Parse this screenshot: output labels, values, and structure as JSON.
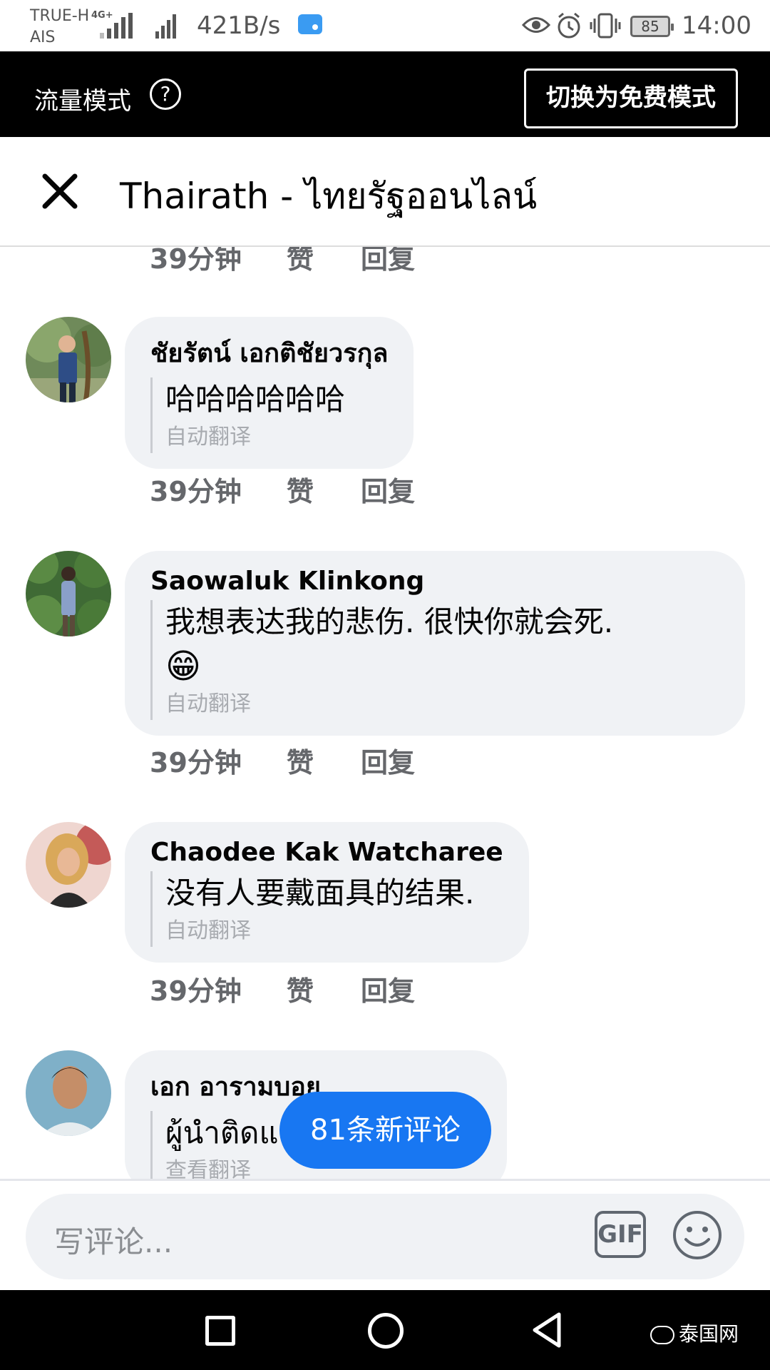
{
  "status_bar": {
    "carrier_line1": "TRUE-H",
    "carrier_line2": "AIS",
    "network_type": "4G+",
    "net_speed": "421B/s",
    "battery_level": "85",
    "time": "14:00",
    "icons": [
      "signal-icon",
      "signal-icon",
      "message-icon",
      "eye-icon",
      "alarm-icon",
      "vibrate-icon",
      "battery-icon"
    ]
  },
  "banner": {
    "mode_label": "流量模式",
    "help_glyph": "?",
    "switch_button": "切换为免费模式"
  },
  "header": {
    "title": "Thairath - ไทยรัฐออนไลน์",
    "close_icon": "close-icon"
  },
  "actions": {
    "time": "39分钟",
    "like": "赞",
    "reply": "回复"
  },
  "comments": [
    {
      "author": "ชัยรัตน์ เอกติชัยวรกุล",
      "text": "哈哈哈哈哈哈",
      "translate_label": "自动翻译"
    },
    {
      "author": "Saowaluk Klinkong",
      "text": "我想表达我的悲伤. 很快你就会死.",
      "emoji": "😁",
      "translate_label": "自动翻译"
    },
    {
      "author": "Chaodee Kak Watcharee",
      "text": "没有人要戴面具的结果.",
      "translate_label": "自动翻译"
    },
    {
      "author": "เอก อารามบอย",
      "text": "ผู้นำติดแล",
      "translate_label": "查看翻译"
    }
  ],
  "new_comments_button": "81条新评论",
  "composer": {
    "placeholder": "写评论...",
    "gif_label": "GIF"
  },
  "watermark": "泰国网",
  "colors": {
    "accent": "#1877f2",
    "bubble": "#f0f2f5",
    "secondary_text": "#65676b",
    "banner_bg": "#000000"
  }
}
